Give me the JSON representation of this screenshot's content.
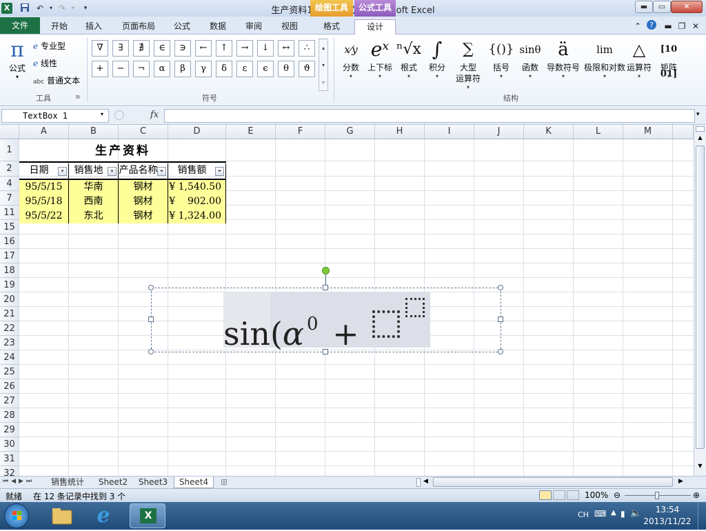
{
  "titlebar": {
    "title": "生产资料1 [兼容模式] - Microsoft Excel",
    "ctx_draw": "绘图工具",
    "ctx_formula": "公式工具",
    "qat_icons": [
      "excel-logo-icon",
      "save-icon",
      "undo-icon",
      "redo-icon",
      "customize-qat-icon"
    ]
  },
  "tabs": {
    "file": "文件",
    "home": "开始",
    "insert": "插入",
    "layout": "页面布局",
    "formulas": "公式",
    "data": "数据",
    "review": "审阅",
    "view": "视图",
    "format": "格式",
    "design": "设计"
  },
  "ribbon": {
    "tools": {
      "equation": "公式",
      "professional": "专业型",
      "linear": "线性",
      "normal_text_prefix": "abc",
      "normal_text": "普通文本",
      "group_label": "工具"
    },
    "symbols": {
      "row1": [
        "∇",
        "∃",
        "∄",
        "∈",
        "∋",
        "←",
        "↑",
        "→",
        "↓",
        "↔",
        "∴"
      ],
      "row2": [
        "+",
        "−",
        "¬",
        "α",
        "β",
        "γ",
        "δ",
        "ε",
        "ϵ",
        "θ",
        "ϑ"
      ],
      "group_label": "符号"
    },
    "structures": {
      "items": [
        {
          "glyph": "x⁄y",
          "label": "分数"
        },
        {
          "glyph": "eˣ",
          "label": "上下标"
        },
        {
          "glyph": "ⁿ√x",
          "label": "根式"
        },
        {
          "glyph": "∫",
          "label": "积分"
        },
        {
          "glyph": "∑",
          "label": "大型\n运算符"
        },
        {
          "glyph": "{()}",
          "label": "括号"
        },
        {
          "glyph": "sinθ",
          "label": "函数"
        },
        {
          "glyph": "ä",
          "label": "导数符号"
        },
        {
          "glyph": "lim",
          "label": "极限和对数"
        },
        {
          "glyph": "△",
          "label": "运算符"
        },
        {
          "glyph": "[10 01]",
          "label": "矩阵"
        }
      ],
      "group_label": "结构"
    }
  },
  "formula_bar": {
    "name_box": "TextBox 1",
    "fx": "fx",
    "content": ""
  },
  "sheet": {
    "columns": [
      "A",
      "B",
      "C",
      "D",
      "E",
      "F",
      "G",
      "H",
      "I",
      "J",
      "K",
      "L",
      "M"
    ],
    "rows": [
      "1",
      "2",
      "4",
      "7",
      "11",
      "15",
      "16",
      "17",
      "18",
      "19",
      "20",
      "21",
      "22",
      "23",
      "24",
      "25",
      "26",
      "27",
      "28",
      "29",
      "30",
      "31",
      "32"
    ],
    "title": "生产资料",
    "headers": [
      "日期",
      "销售地",
      "产品名称",
      "销售额"
    ],
    "data": [
      [
        "95/5/15",
        "华南",
        "钢材",
        "¥ 1,540.50"
      ],
      [
        "95/5/18",
        "西南",
        "钢材",
        "¥    902.00"
      ],
      [
        "95/5/22",
        "东北",
        "钢材",
        "¥ 1,324.00"
      ]
    ]
  },
  "equation": {
    "func": "sin(",
    "var": "α",
    "sup": "0",
    "op": "+"
  },
  "sheet_tabs": [
    "销售统计",
    "Sheet2",
    "Sheet3",
    "Sheet4"
  ],
  "status": {
    "ready": "就绪",
    "filter_msg": "在 12 条记录中找到 3 个",
    "zoom": "100%"
  },
  "taskbar": {
    "lang": "CH",
    "time": "13:54",
    "date": "2013/11/22"
  }
}
